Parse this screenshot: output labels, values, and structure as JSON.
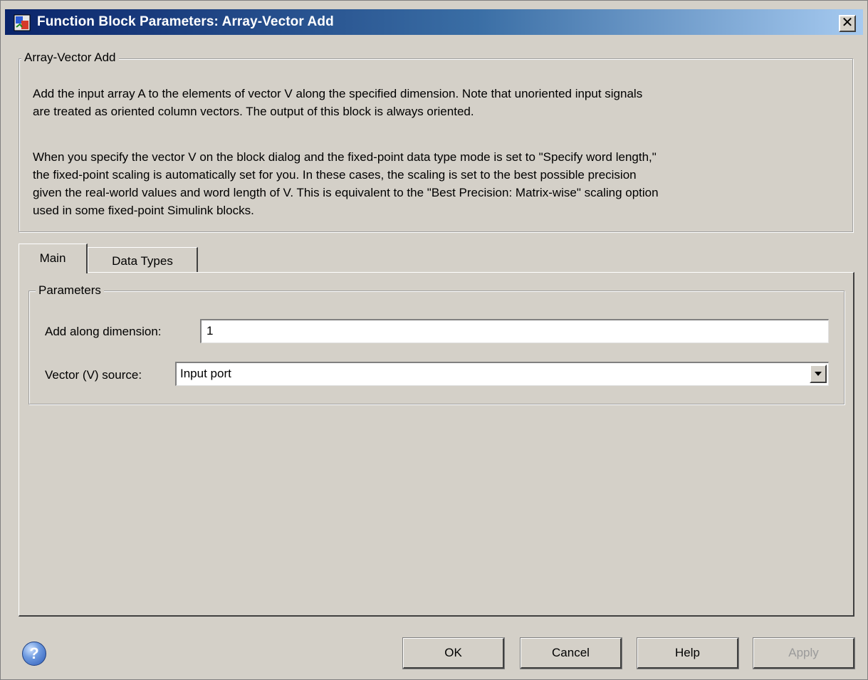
{
  "window": {
    "title": "Function Block Parameters: Array-Vector Add",
    "close_glyph": "✕"
  },
  "description_group": {
    "legend": "Array-Vector Add",
    "paragraph1": "Add the input array A to the elements of vector V along the specified dimension.  Note that unoriented input signals\nare treated as oriented column vectors. The output of this block is always oriented.",
    "paragraph2": "When you specify the vector V on the block dialog and the fixed-point data type mode is set to \"Specify word length,\"\nthe fixed-point scaling is automatically set for you. In these cases, the scaling is set to the best possible precision\ngiven the real-world values and word length of V. This is equivalent to the \"Best Precision: Matrix-wise\" scaling option\nused in some fixed-point Simulink blocks."
  },
  "tabs": [
    {
      "label": "Main",
      "selected": true
    },
    {
      "label": "Data Types",
      "selected": false
    }
  ],
  "parameters": {
    "legend": "Parameters",
    "add_along_dimension_label": "Add along dimension:",
    "add_along_dimension_value": "1",
    "vector_source_label": "Vector (V) source:",
    "vector_source_value": "Input port"
  },
  "buttons": {
    "ok": "OK",
    "cancel": "Cancel",
    "help": "Help",
    "apply": "Apply"
  },
  "help_icon_glyph": "?",
  "colors": {
    "titlebar_start": "#0a246a",
    "titlebar_end": "#a6caf0",
    "dialog_bg": "#d4d0c8"
  },
  "icons": [
    "simulink-block-icon",
    "close-icon",
    "chevron-down-icon",
    "help-icon"
  ]
}
